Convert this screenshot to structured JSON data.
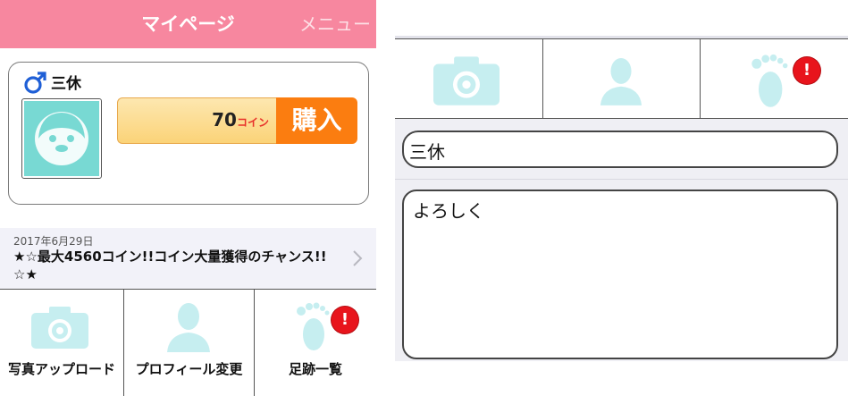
{
  "header": {
    "title": "マイページ",
    "menu_label": "メニュー"
  },
  "profile": {
    "gender_icon": "male-symbol-icon",
    "name": "三休"
  },
  "coins": {
    "value": "70",
    "unit": "コイン",
    "buy_label": "購入"
  },
  "news": {
    "date": "2017年6月29日",
    "text": "★☆最大4560コイン!!コイン大量獲得のチャンス!!☆★"
  },
  "tiles": [
    {
      "label": "写真アップロード",
      "icon": "camera-icon"
    },
    {
      "label": "プロフィール変更",
      "icon": "person-silhouette-icon"
    },
    {
      "label": "足跡一覧",
      "icon": "footprint-icon",
      "badge": "!"
    }
  ],
  "edit": {
    "name_value": "三休",
    "bio_value": "よろしく",
    "badge": "!"
  },
  "colors": {
    "header": "#f7879f",
    "buy_button": "#fb7d10",
    "icon_teal": "#7fd9dc",
    "badge_red": "#e8141c"
  }
}
